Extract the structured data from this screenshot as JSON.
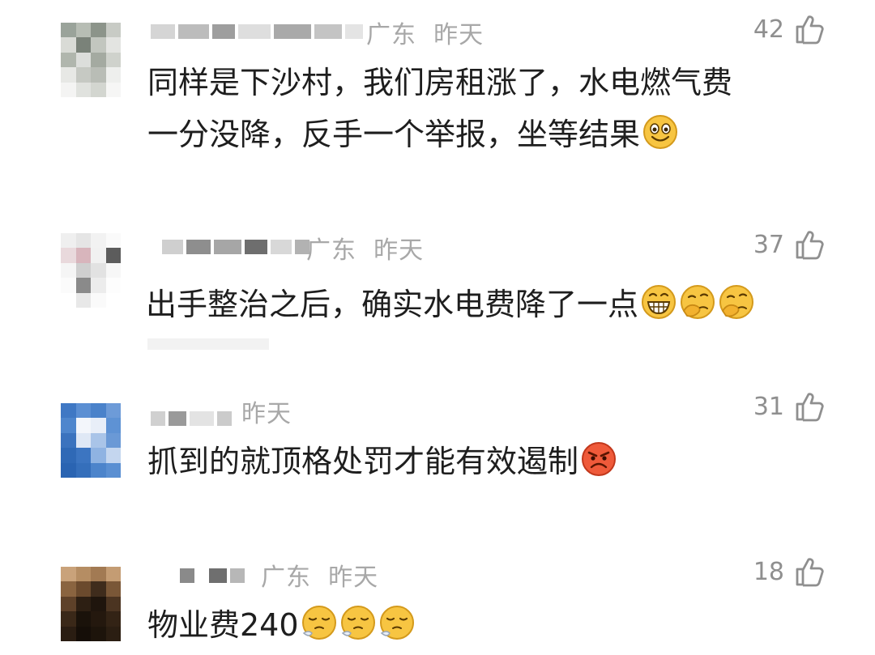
{
  "comments": [
    {
      "location": "广东",
      "time": "昨天",
      "likes": "42",
      "lines": [
        "同样是下沙村，我们房租涨了，水电燃气费",
        "一分没降，反手一个举报，坐等结果"
      ],
      "emojis": [
        "smile-emoji"
      ]
    },
    {
      "location": "广东",
      "time": "昨天",
      "likes": "37",
      "lines": [
        "出手整治之后，确实水电费降了一点"
      ],
      "emojis": [
        "grin-emoji",
        "thinking-emoji",
        "thinking-emoji"
      ]
    },
    {
      "location": "",
      "time": "昨天",
      "likes": "31",
      "lines": [
        "抓到的就顶格处罚才能有效遏制"
      ],
      "emojis": [
        "angry-emoji"
      ]
    },
    {
      "location": "广东",
      "time": "昨天",
      "likes": "18",
      "lines": [
        "物业费240"
      ],
      "emojis": [
        "sigh-emoji",
        "sigh-emoji",
        "sigh-emoji"
      ]
    }
  ],
  "colors": {
    "text": "#1e1e1e",
    "meta": "#a8a8a8",
    "like": "#8f8f8f",
    "emoji": "#f7c542"
  }
}
